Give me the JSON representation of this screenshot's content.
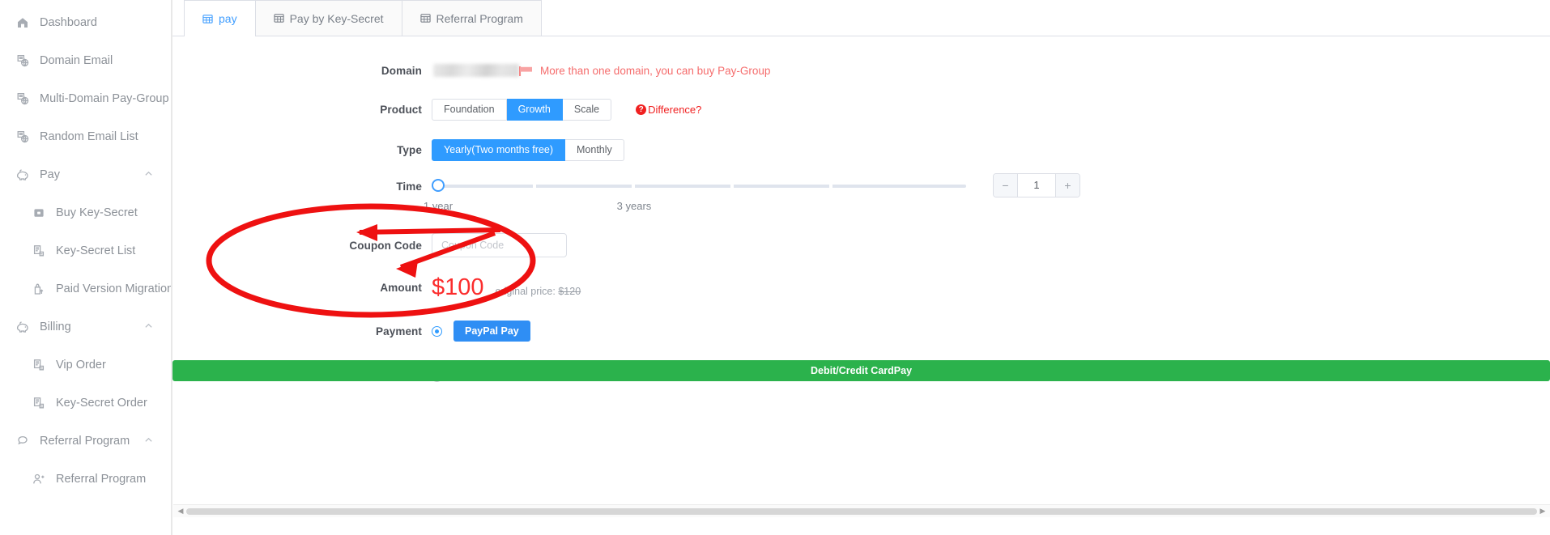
{
  "sidebar": {
    "items": [
      {
        "label": "Dashboard",
        "icon": "home-icon",
        "level": 0,
        "expandable": false
      },
      {
        "label": "Domain Email",
        "icon": "domain-email-icon",
        "level": 0,
        "expandable": false
      },
      {
        "label": "Multi-Domain Pay-Group",
        "icon": "pay-group-icon",
        "level": 0,
        "expandable": false
      },
      {
        "label": "Random Email List",
        "icon": "random-email-icon",
        "level": 0,
        "expandable": false
      },
      {
        "label": "Pay",
        "icon": "pay-icon",
        "level": 0,
        "expandable": true,
        "expanded": true
      },
      {
        "label": "Buy Key-Secret",
        "icon": "buy-key-secret-icon",
        "level": 1,
        "expandable": false
      },
      {
        "label": "Key-Secret List",
        "icon": "key-secret-list-icon",
        "level": 1,
        "expandable": false
      },
      {
        "label": "Paid Version Migration",
        "icon": "paid-migration-icon",
        "level": 1,
        "expandable": false
      },
      {
        "label": "Billing",
        "icon": "billing-icon",
        "level": 0,
        "expandable": true,
        "expanded": true
      },
      {
        "label": "Vip Order",
        "icon": "vip-order-icon",
        "level": 1,
        "expandable": false
      },
      {
        "label": "Key-Secret Order",
        "icon": "key-secret-order-icon",
        "level": 1,
        "expandable": false
      },
      {
        "label": "Referral Program",
        "icon": "referral-icon",
        "level": 0,
        "expandable": true,
        "expanded": true
      },
      {
        "label": "Referral Program",
        "icon": "referral-sub-icon",
        "level": 1,
        "expandable": false
      }
    ]
  },
  "tabs": [
    {
      "label": "pay",
      "icon": "table-icon",
      "active": true
    },
    {
      "label": "Pay by Key-Secret",
      "icon": "table-icon",
      "active": false
    },
    {
      "label": "Referral Program",
      "icon": "table-icon",
      "active": false
    }
  ],
  "form": {
    "domain": {
      "label": "Domain",
      "value": "",
      "hint": "More than one domain, you can buy Pay-Group"
    },
    "product": {
      "label": "Product",
      "options": [
        "Foundation",
        "Growth",
        "Scale"
      ],
      "selected": "Growth",
      "difference_link": "Difference?"
    },
    "type": {
      "label": "Type",
      "options": [
        "Yearly(Two months free)",
        "Monthly"
      ],
      "selected": "Yearly(Two months free)"
    },
    "time": {
      "label": "Time",
      "marks": [
        "1 year",
        "3 years"
      ],
      "value": 1,
      "quantity": "1",
      "minus_label": "−",
      "plus_label": "+"
    },
    "coupon": {
      "label": "Coupon Code",
      "value": "",
      "placeholder": "Coupon Code"
    },
    "amount": {
      "label": "Amount",
      "price": "$100",
      "original_label": "original price:",
      "original_price": "$120"
    },
    "payment": {
      "label": "Payment",
      "options": [
        {
          "label": "PayPal Pay",
          "selected": true,
          "color": "#2f8ef4"
        },
        {
          "label": "Debit/Credit CardPay",
          "selected": false,
          "color": "#2bb24c"
        }
      ]
    }
  },
  "scrollbar": {
    "left_arrow": "◀",
    "right_arrow": "▶"
  },
  "colors": {
    "accent": "#409EFF",
    "primary_button": "#2f9bff",
    "paypal": "#2f8ef4",
    "card_pay": "#2bb24c",
    "price_red": "#fb2d2d",
    "hint_red": "#f56c6c",
    "annotation_red": "#ee1111"
  }
}
